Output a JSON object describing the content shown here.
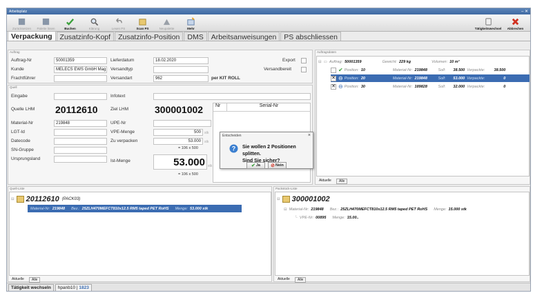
{
  "window": {
    "title": "Arbeitsplatz"
  },
  "toolbar": {
    "buttons": [
      {
        "label": "Zurücksetzen",
        "icon": "reset-icon",
        "enabled": false
      },
      {
        "label": "Palette lösen",
        "icon": "pallet-icon",
        "enabled": false
      },
      {
        "label": "Buchen",
        "icon": "check-icon",
        "enabled": true
      },
      {
        "label": "Klärung",
        "icon": "search-icon",
        "enabled": true
      },
      {
        "label": "Lesen PS",
        "icon": "undo-icon",
        "enabled": false
      },
      {
        "label": "Scan PS",
        "icon": "scan-icon",
        "enabled": true
      },
      {
        "label": "Neupalette",
        "icon": "box-icon",
        "enabled": false
      },
      {
        "label": "Mehr",
        "icon": "more-icon",
        "enabled": true
      }
    ],
    "right_buttons": [
      {
        "label": "Tätigkeitswechsel",
        "icon": "switch-icon"
      },
      {
        "label": "Abbrechen",
        "icon": "cancel-icon"
      }
    ]
  },
  "tabs": [
    "Verpackung",
    "Zusatzinfo-Kopf",
    "Zusatzinfo-Position",
    "DMS",
    "Arbeitsanweisungen",
    "PS abschliessen"
  ],
  "auftrag": {
    "group_label": "Auftrag",
    "auftrag_nr_label": "Auftrag-Nr",
    "auftrag_nr": "50001359",
    "lieferdatum_label": "Lieferdatum",
    "lieferdatum": "18.02.2020",
    "export_label": "Export",
    "kunde_label": "Kunde",
    "kunde": "MELECS EWS GmbH Mag",
    "versandtyp_label": "Versandtyp",
    "versandtyp": "",
    "versandbereit_label": "Versandbereit",
    "frachtfuehrer_label": "Frachtführer",
    "frachtfuehrer": "",
    "versandart_label": "Versandart",
    "versandart": "962",
    "versandart_text": "per KIT ROLL"
  },
  "quell": {
    "group_label": "Quell",
    "eingabe_label": "Eingabe",
    "eingabe": "",
    "infotext_label": "Infotext",
    "infotext": "",
    "quelle_lhm_label": "Quelle LHM",
    "quelle_lhm": "20112610",
    "ziel_lhm_label": "Ziel LHM",
    "ziel_lhm": "300001002",
    "nr_label": "Nr",
    "serial_label": "Serial-Nr",
    "material_label": "Material-Nr",
    "material": "219848",
    "upe_label": "UPE-Nr",
    "upe": "",
    "lgt_label": "LGT-Id",
    "lgt": "",
    "vpe_label": "VPE-Menge",
    "vpe": "500",
    "vpe_unit": "stk",
    "datecode_label": "Datecode",
    "datecode": "",
    "zu_verpacken_label": "Zu verpacken",
    "zu_verpacken": "53.000",
    "zu_verpacken_unit": "stk",
    "calc1": "= 106 x 500",
    "sn_label": "SN-Gruppe",
    "sn": "",
    "ursprung_label": "Ursprungsland",
    "ursprung": "",
    "ist_label": "Ist-Menge",
    "ist": "53.000",
    "ist_unit": "stk",
    "calc2": "= 106 x 500"
  },
  "auftragsdaten": {
    "label": "Auftragsdaten",
    "root": {
      "k": "Auftrag:",
      "v": "50001359",
      "gew_k": "Gewicht:",
      "gew_v": "229 kg",
      "vol_k": "Volumen:",
      "vol_v": "10 m³"
    },
    "rows": [
      {
        "pos": "10",
        "mat": "219848",
        "soll": "38.500",
        "verp": "38.500"
      },
      {
        "pos": "20",
        "mat": "219848",
        "soll": "53.000",
        "verp": "0"
      },
      {
        "pos": "30",
        "mat": "189828",
        "soll": "32.000",
        "verp": "0"
      }
    ],
    "pos_k": "Position:",
    "mat_k": "Material-Nr:",
    "soll_k": "Soll:",
    "verp_k": "Verpackte:"
  },
  "filters": {
    "aktuelle": "Aktuelle",
    "alle": "Alle"
  },
  "quell_liste": {
    "label": "Quell-Liste",
    "lhm": "20112610",
    "type": "(PACK03)",
    "mat_k": "Material-Nr:",
    "mat": "219848",
    "bez_k": "Bez.:",
    "bez": "25ZLH470MEFCT810x12.5 RM5 taped PET RoHS",
    "menge_k": "Menge:",
    "menge": "53.000 stk"
  },
  "packstueck_liste": {
    "label": "Packstück-Liste",
    "lhm": "300001002",
    "mat_k": "Material-Nr:",
    "mat": "219848",
    "bez_k": "Bez.:",
    "bez": "25ZLH470MEFCT810x12.5 RM5 taped PET RoHS",
    "menge_k": "Menge:",
    "menge": "15.000 stk",
    "vpe_k": "VPE-Nr:",
    "vpe": "00895",
    "vmenge_k": "Menge:",
    "vmenge": "15.00.."
  },
  "dialog": {
    "title": "Entscheiden",
    "line1": "Sie wollen 2 Positionen splitten.",
    "line2": "Sind Sie sicher?",
    "yes": "Ja",
    "no": "Nein"
  },
  "statusbar": {
    "switch": "Tätigkeit wechseln",
    "user": "hpanb10",
    "sep": " | ",
    "count": "1823"
  },
  "colors": {
    "accent": "#3b6cb2",
    "ok": "#3aa03a",
    "cancel": "#d03020"
  }
}
